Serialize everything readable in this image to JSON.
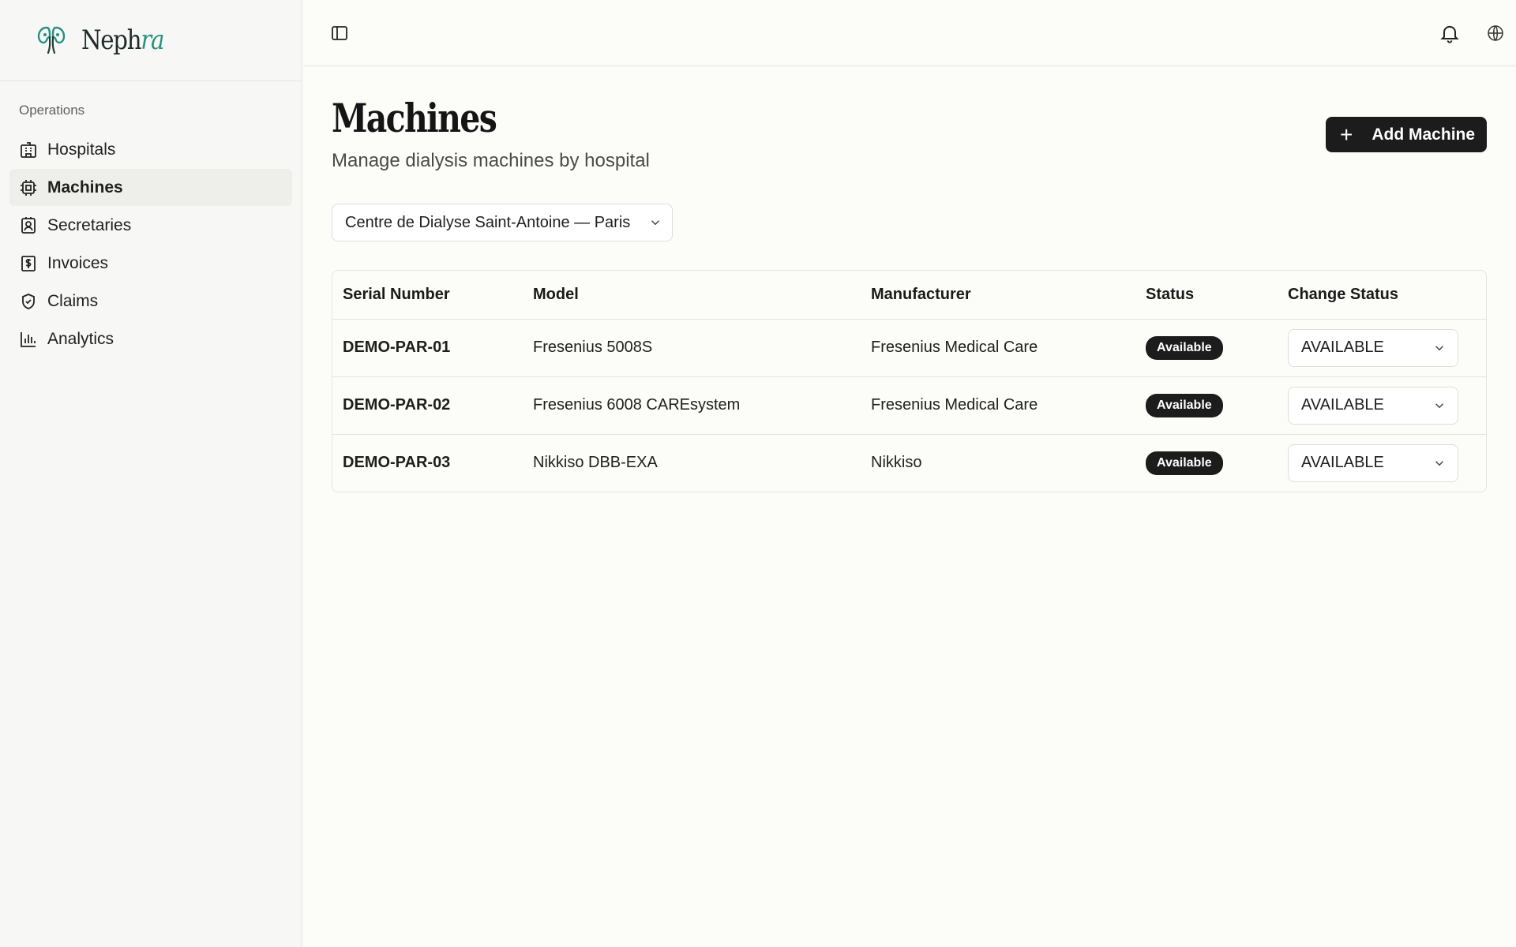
{
  "brand": {
    "name_main": "Neph",
    "name_accent": "ra"
  },
  "sidebar": {
    "section_label": "Operations",
    "items": [
      {
        "label": "Hospitals",
        "icon": "building-icon",
        "active": false
      },
      {
        "label": "Machines",
        "icon": "cpu-icon",
        "active": true
      },
      {
        "label": "Secretaries",
        "icon": "contact-icon",
        "active": false
      },
      {
        "label": "Invoices",
        "icon": "receipt-icon",
        "active": false
      },
      {
        "label": "Claims",
        "icon": "shield-check-icon",
        "active": false
      },
      {
        "label": "Analytics",
        "icon": "bar-chart-icon",
        "active": false
      }
    ]
  },
  "page": {
    "title": "Machines",
    "subtitle": "Manage dialysis machines by hospital",
    "add_button_label": "Add Machine"
  },
  "hospital_select": {
    "value": "Centre de Dialyse Saint-Antoine — Paris"
  },
  "table": {
    "columns": [
      "Serial Number",
      "Model",
      "Manufacturer",
      "Status",
      "Change Status"
    ],
    "rows": [
      {
        "serial": "DEMO-PAR-01",
        "model": "Fresenius 5008S",
        "manufacturer": "Fresenius Medical Care",
        "status": "Available",
        "change_status": "AVAILABLE"
      },
      {
        "serial": "DEMO-PAR-02",
        "model": "Fresenius 6008 CAREsystem",
        "manufacturer": "Fresenius Medical Care",
        "status": "Available",
        "change_status": "AVAILABLE"
      },
      {
        "serial": "DEMO-PAR-03",
        "model": "Nikkiso DBB-EXA",
        "manufacturer": "Nikkiso",
        "status": "Available",
        "change_status": "AVAILABLE"
      }
    ]
  },
  "colors": {
    "accent": "#2a8f83",
    "primary_button": "#1c1c1c",
    "background": "#fcfcf9"
  }
}
